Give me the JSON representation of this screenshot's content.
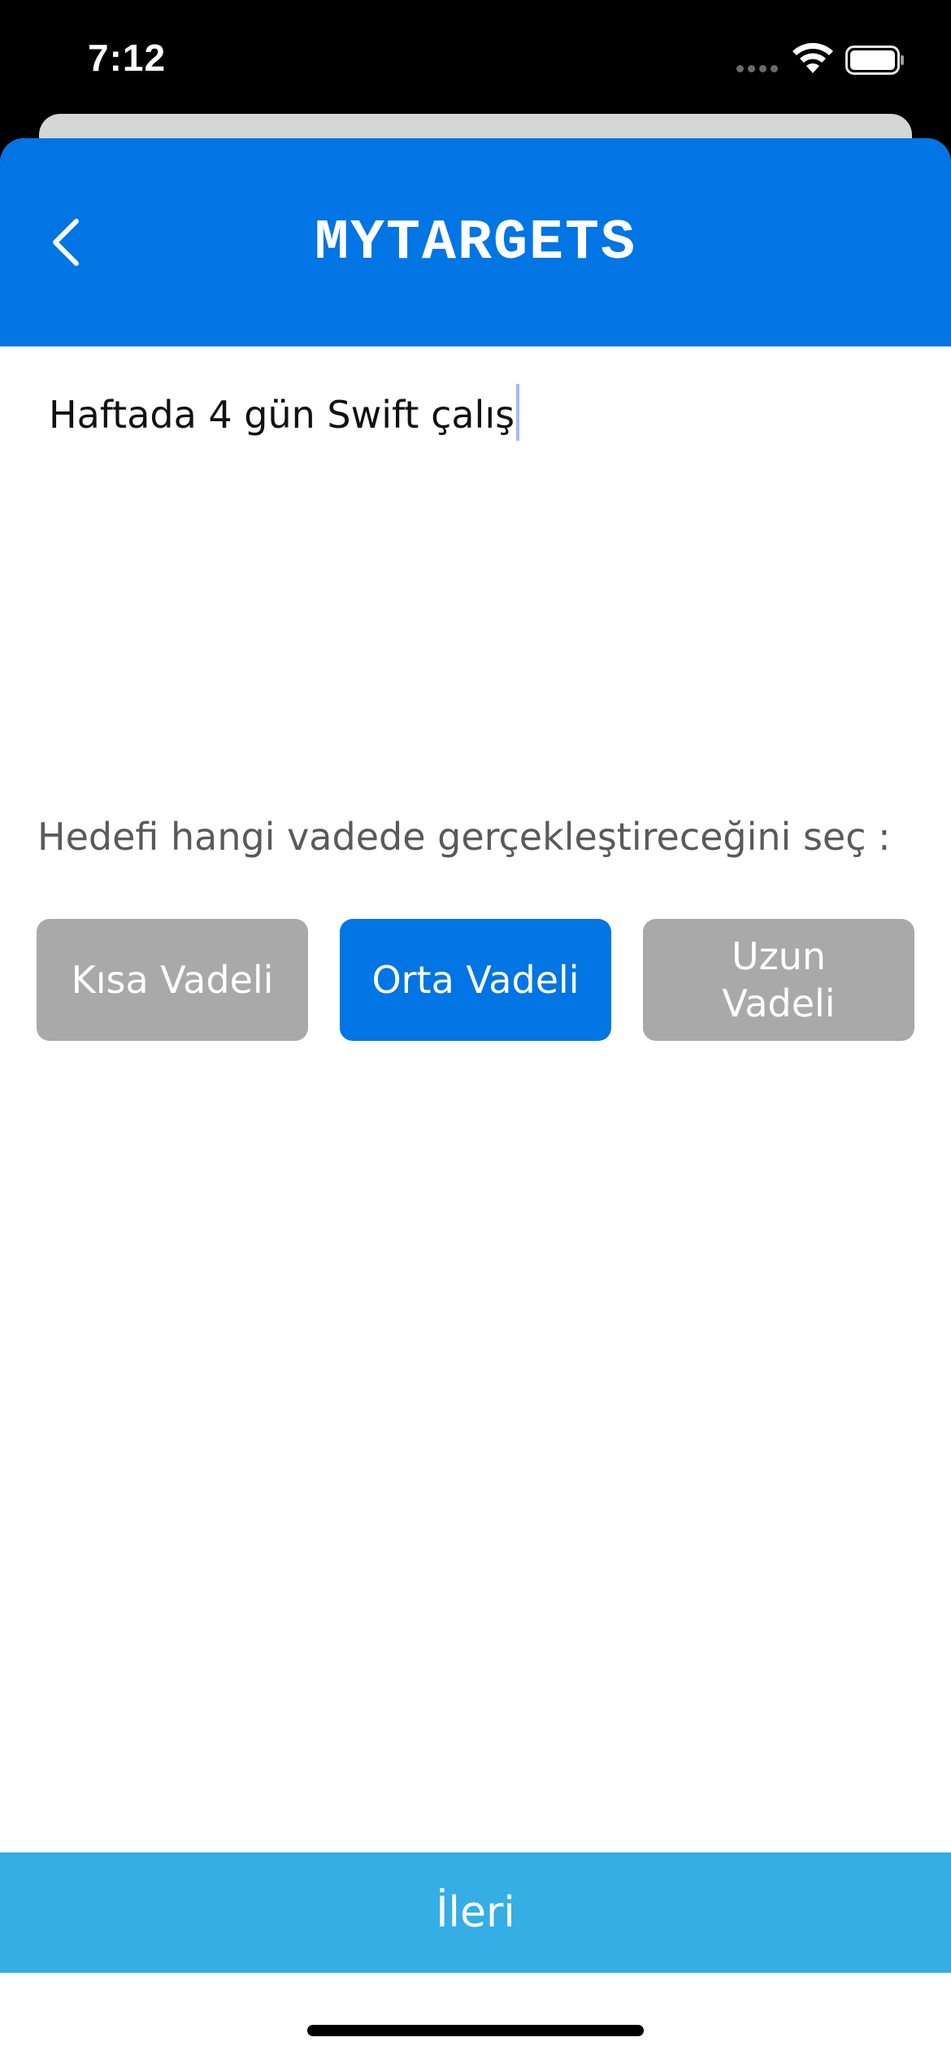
{
  "status_bar": {
    "time": "7:12",
    "icons": [
      "cellular-dots-icon",
      "wifi-icon",
      "battery-icon"
    ]
  },
  "nav": {
    "title": "MYTARGETS",
    "back_icon": "chevron-left-icon"
  },
  "target_input": {
    "value": "Haftada 4 gün Swift çalış"
  },
  "term_selection": {
    "label": "Hedefi hangi vadede gerçekleştireceğini seç :",
    "options": [
      {
        "label": "Kısa Vadeli",
        "selected": false
      },
      {
        "label": "Orta Vadeli",
        "selected": true
      },
      {
        "label": "Uzun Vadeli",
        "selected": false
      }
    ]
  },
  "footer": {
    "next_label": "İleri"
  },
  "colors": {
    "primary": "#0075e3",
    "next_button": "#34aee5",
    "unselected": "#a9a9a9",
    "label": "#5a5a5a"
  }
}
